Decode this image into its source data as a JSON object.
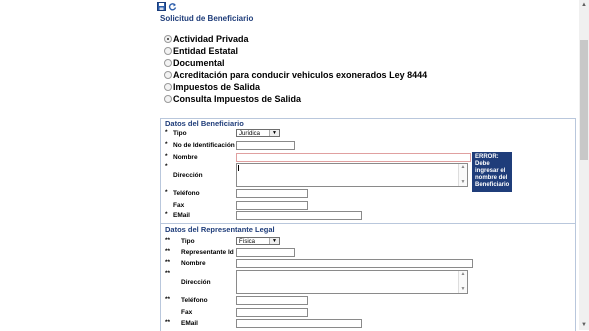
{
  "toolbar": {
    "icons": [
      "save-icon",
      "refresh-icon"
    ]
  },
  "page_title": "Solicitud de Beneficiario",
  "radio_options": [
    {
      "label": "Actividad Privada",
      "selected": true
    },
    {
      "label": "Entidad Estatal",
      "selected": false
    },
    {
      "label": "Documental",
      "selected": false
    },
    {
      "label": "Acreditación para conducir vehiculos exonerados Ley 8444",
      "selected": false
    },
    {
      "label": "Impuestos de Salida",
      "selected": false
    },
    {
      "label": "Consulta Impuestos de Salida",
      "selected": false
    }
  ],
  "beneficiario": {
    "title": "Datos del Beneficiario",
    "tipo_label": "Tipo",
    "tipo_value": "Jurídica",
    "id_label": "No de Identificación",
    "nombre_label": "Nombre",
    "direccion_label": "Dirección",
    "telefono_label": "Teléfono",
    "fax_label": "Fax",
    "email_label": "EMail",
    "required_mark": "*"
  },
  "error": {
    "title": "ERROR:",
    "message": "Debe ingresar el nombre del Beneficiario"
  },
  "representante": {
    "title": "Datos del Representante Legal",
    "tipo_label": "Tipo",
    "tipo_value": "Física",
    "id_label": "Representante Id",
    "nombre_label": "Nombre",
    "direccion_label": "Dirección",
    "telefono_label": "Teléfono",
    "fax_label": "Fax",
    "email_label": "EMail",
    "required_mark": "**"
  }
}
